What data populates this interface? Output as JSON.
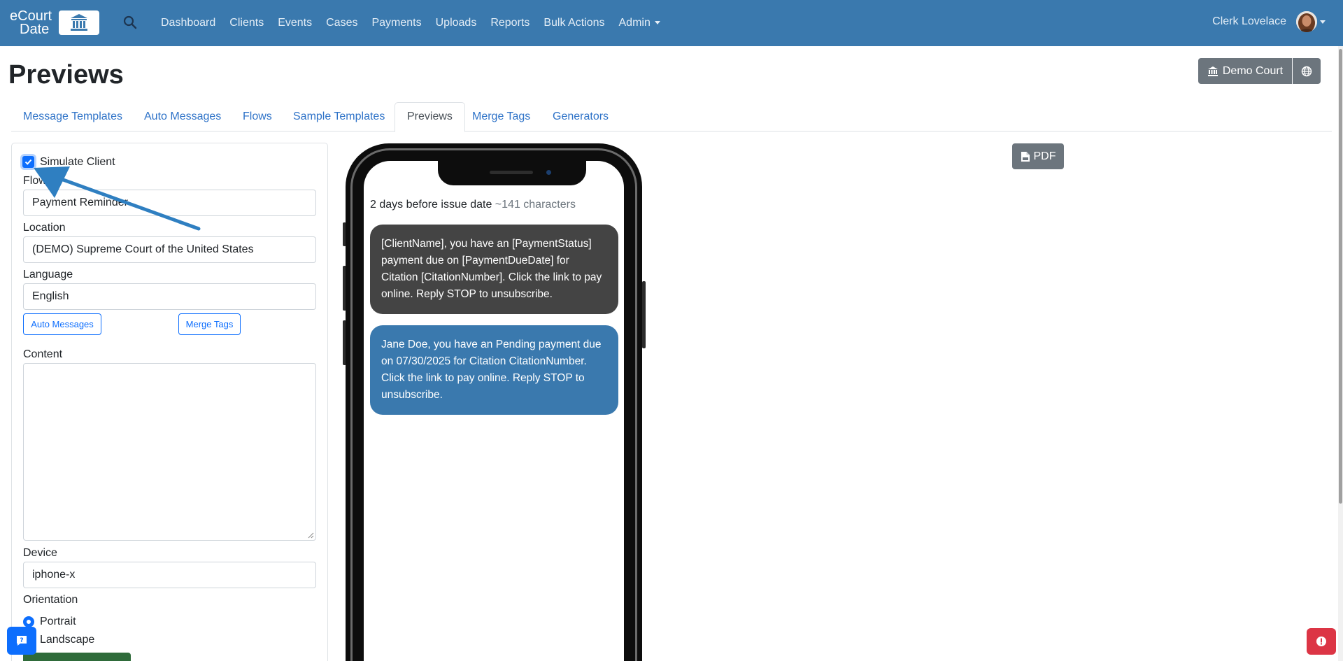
{
  "brand": {
    "line1": "eCourt",
    "line2": "Date"
  },
  "nav": {
    "items": [
      "Dashboard",
      "Clients",
      "Events",
      "Cases",
      "Payments",
      "Uploads",
      "Reports",
      "Bulk Actions"
    ],
    "admin": "Admin",
    "user": "Clerk Lovelace"
  },
  "page": {
    "title": "Previews",
    "court_button": "Demo Court",
    "pdf_button": "PDF"
  },
  "tabs": {
    "items": [
      "Message Templates",
      "Auto Messages",
      "Flows",
      "Sample Templates",
      "Previews",
      "Merge Tags",
      "Generators"
    ],
    "active": "Previews"
  },
  "form": {
    "simulate_label": "Simulate Client",
    "simulate_checked": true,
    "flow_label": "Flow",
    "flow_value": "Payment Reminder",
    "location_label": "Location",
    "location_value": "(DEMO) Supreme Court of the United States",
    "language_label": "Language",
    "language_value": "English",
    "auto_messages_button": "Auto Messages",
    "merge_tags_button": "Merge Tags",
    "content_label": "Content",
    "content_value": "",
    "device_label": "Device",
    "device_value": "iphone-x",
    "orientation_label": "Orientation",
    "portrait_label": "Portrait",
    "landscape_label": "Landscape",
    "orientation_selected": "Portrait"
  },
  "preview": {
    "schedule": "2 days before issue date",
    "char_count": "~141 characters",
    "template_message": "[ClientName], you have an [PaymentStatus] payment due on [PaymentDueDate] for Citation [CitationNumber]. Click the link to pay online. Reply STOP to unsubscribe.",
    "rendered_message": "Jane Doe, you have an Pending payment due on 07/30/2025 for Citation CitationNumber. Click the link to pay online. Reply STOP to unsubscribe."
  },
  "colors": {
    "navbar": "#3a79ae",
    "link": "#2f73c8",
    "primary": "#0d6efd",
    "secondary": "#6c757d",
    "template_bubble": "#444444",
    "rendered_bubble": "#3a79ae",
    "danger": "#dc3545"
  },
  "icons": [
    "search-icon",
    "court-icon",
    "globe-icon",
    "pdf-file-icon",
    "chat-help-icon",
    "alert-icon",
    "chevron-down-icon"
  ]
}
